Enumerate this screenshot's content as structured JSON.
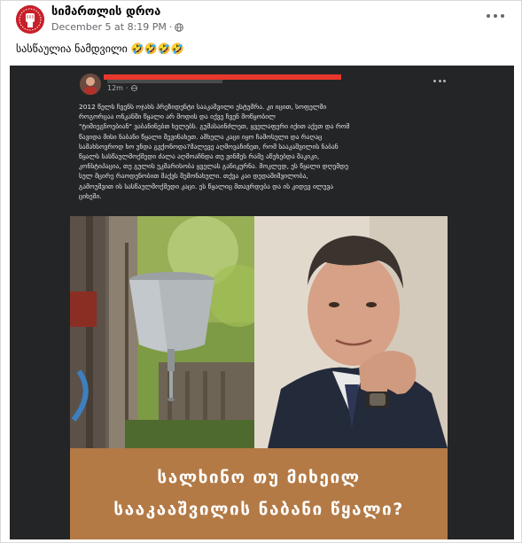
{
  "post": {
    "author": "სიმართლის დროა",
    "timestamp": "December 5 at 8:19 PM",
    "separator": "·",
    "caption": "სასწაულია ნამდვილი",
    "caption_emojis": "🤣🤣🤣🤣"
  },
  "shared_post": {
    "timestamp": "12m",
    "separator": "·",
    "body_lines": [
      "2012 წელს ჩვენს ოჯახს პრეზიდენტი სააკაშვილი ესტუმრა. კი იცით, სოფელში",
      "როგორცაა ონკანში წყალი არ მოდის და იქვე ჩვენ მოწყობილ",
      "\"ტიმიეგნოებიან\" ვაბანინებთ ხელებს. გუმასაინძლეთ, ყველაფერი იქით აქეთ და რომ",
      "წავიდა მისი ნაბანი წყალი შევინახეთ. ამხელა კაცი იყო ჩამოსული და რაღაც",
      "სამახსოვროდ ხო უნდა გვქონოდა?მალევე აღმოვაჩინეთ, რომ სააკაშვილის ნაბან",
      "წყალს სასწაულმოქმედი ძალა აღმოაჩნდა თუ ვინმეს რამე აწუხებდა შაკიკი,",
      "კონსტიპაცია, თუ გულის უკმარისობა ყველას განიკურნა. მოკლედ, ეს წყალი დღემდე",
      "სულ მცირე რაოდენობით მაქვს შემონახული. თქვა კაი დედამიშვილობა,",
      "გამოუშვით ის სასწაულმოქმედი კაცი. ეს წყალიც მთავრდება და ის კიდევ ილუვა",
      "ციხეში."
    ],
    "banner_line_1": "სალხინო თუ მიხეილ",
    "banner_line_2": "სააკააშვილის ნაბანი წყალი?"
  },
  "colors": {
    "accent_red": "#e8372c",
    "banner_brown": "#b37a46",
    "dark_bg": "#242526"
  },
  "icons": {
    "globe": "globe-icon",
    "more": "more-options-icon"
  }
}
